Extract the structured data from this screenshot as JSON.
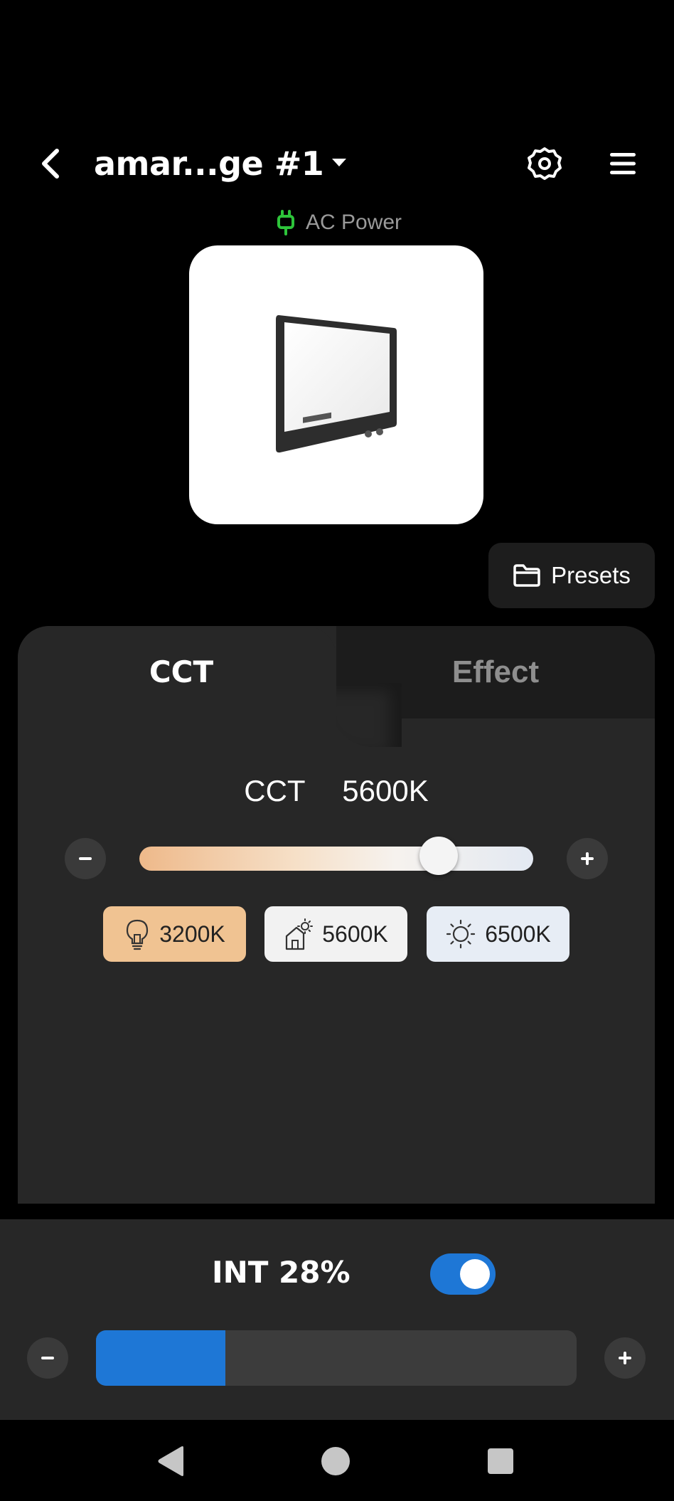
{
  "header": {
    "title": "amar...ge #1",
    "back_icon": "chevron-left-icon",
    "dropdown_icon": "caret-down-icon",
    "settings_icon": "gear-icon",
    "menu_icon": "hamburger-menu-icon"
  },
  "power": {
    "label": "AC Power",
    "icon": "plug-icon",
    "icon_color": "#2dc43a"
  },
  "presets_button": {
    "label": "Presets",
    "icon": "folder-icon"
  },
  "tabs": [
    {
      "label": "CCT",
      "active": true
    },
    {
      "label": "Effect",
      "active": false
    }
  ],
  "cct": {
    "label": "CCT",
    "value_text": "5600K",
    "slider_fraction": 0.76,
    "presets": [
      {
        "label": "3200K",
        "icon": "bulb-icon",
        "color": "#f0c392"
      },
      {
        "label": "5600K",
        "icon": "house-sun-icon",
        "color": "#f2f2f2"
      },
      {
        "label": "6500K",
        "icon": "sun-icon",
        "color": "#e7edf5"
      }
    ]
  },
  "intensity": {
    "label": "INT 28%",
    "percent": 28,
    "toggle_on": true,
    "accent": "#1e77d6"
  },
  "nav": {
    "back_icon": "triangle-back-icon",
    "home_icon": "circle-home-icon",
    "recents_icon": "square-recents-icon"
  }
}
